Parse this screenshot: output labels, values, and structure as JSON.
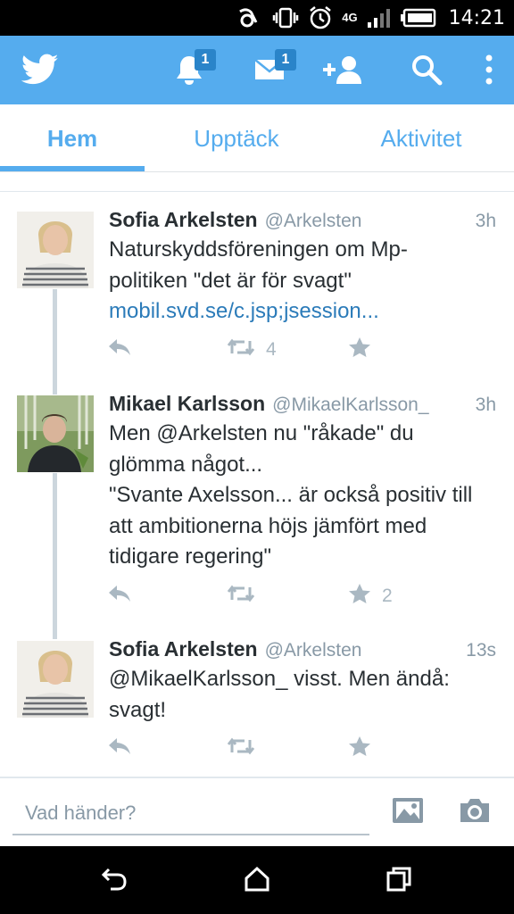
{
  "status_bar": {
    "network": "4G",
    "time": "14:21"
  },
  "header": {
    "notifications_badge": "1",
    "messages_badge": "1"
  },
  "tabs": [
    {
      "label": "Hem",
      "active": true
    },
    {
      "label": "Upptäck",
      "active": false
    },
    {
      "label": "Aktivitet",
      "active": false
    }
  ],
  "tweets": [
    {
      "name": "Sofia Arkelsten",
      "handle": "@Arkelsten",
      "time": "3h",
      "line1": "Naturskyddsföreningen om Mp-",
      "line2": "politiken \"det är för svagt\"",
      "link": "mobil.svd.se/c.jsp;jsession...",
      "retweets": "4",
      "favorites": ""
    },
    {
      "name": "Mikael Karlsson",
      "handle": "@MikaelKarlsson_",
      "time": "3h",
      "line1": "Men @Arkelsten nu \"råkade\" du",
      "line2": "glömma något...",
      "line3": "\"Svante Axelsson... är också positiv till",
      "line4": "att ambitionerna höjs jämfört med",
      "line5": "tidigare regering\"",
      "retweets": "",
      "favorites": "2"
    },
    {
      "name": "Sofia Arkelsten",
      "handle": "@Arkelsten",
      "time": "13s",
      "line1": "@MikaelKarlsson_ visst. Men ändå:",
      "line2": "svagt!",
      "retweets": "",
      "favorites": ""
    }
  ],
  "compose": {
    "placeholder": "Vad händer?"
  },
  "colors": {
    "brand": "#55acee",
    "link": "#2b7bb9",
    "icon_gray": "#aab8c2"
  }
}
